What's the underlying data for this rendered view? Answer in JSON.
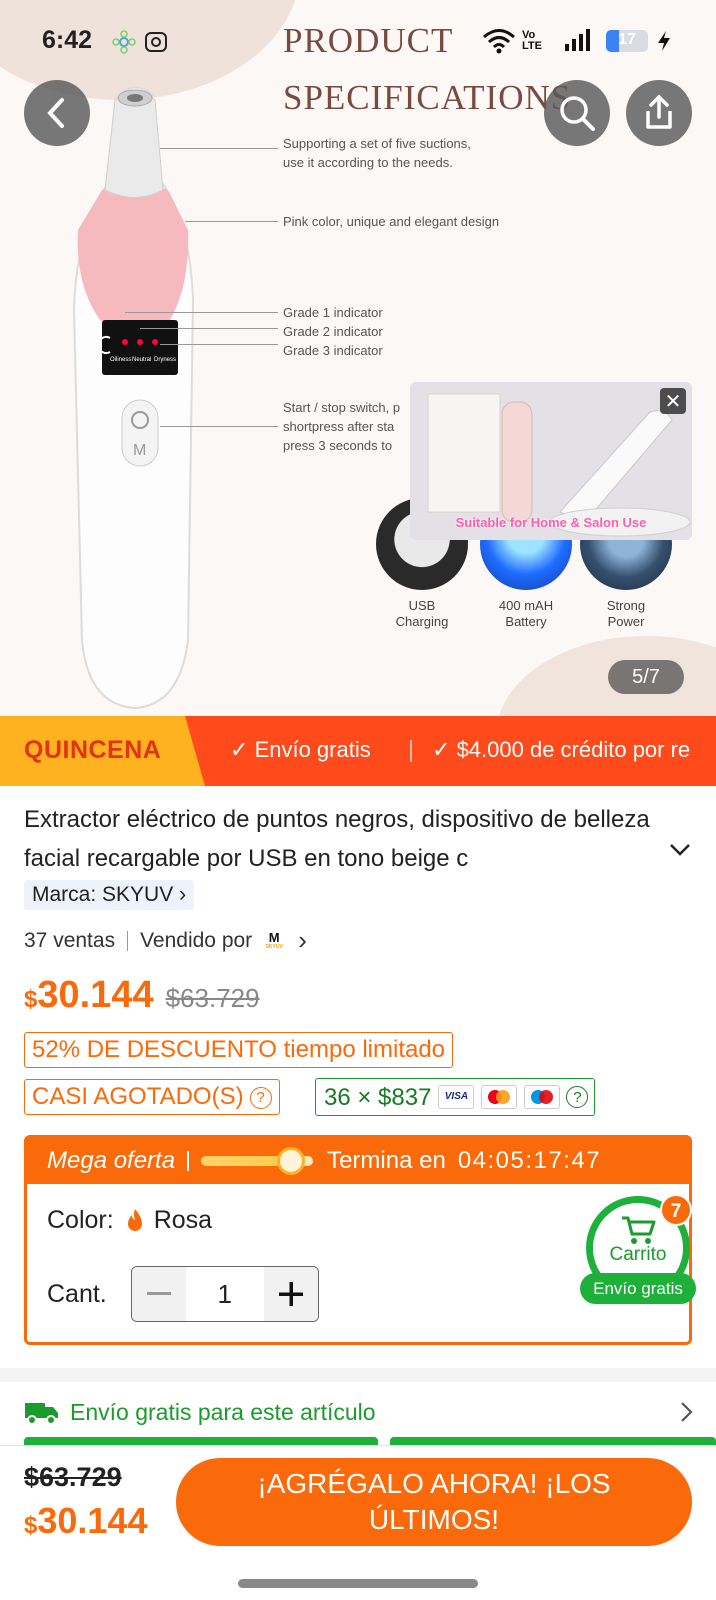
{
  "status_bar": {
    "time": "6:42",
    "network": "Vo LTE",
    "battery": "17"
  },
  "gallery": {
    "page_indicator": "5/7",
    "spec_title_line1": "PRODUCT",
    "spec_title_line2": "SPECIFICATIONS",
    "notes": [
      "Supporting a set of five suctions,",
      "use it according to the needs.",
      "Pink color, unique and elegant design",
      "Grade 1 indicator",
      "Grade 2 indicator",
      "Grade 3 indicator",
      "Start / stop switch, p",
      "shortpress after sta",
      "press 3 seconds to"
    ],
    "video_caption": "Suitable for Home & Salon Use",
    "features": [
      {
        "line1": "USB",
        "line2": "Charging"
      },
      {
        "line1": "400 mAH",
        "line2": "Battery"
      },
      {
        "line1": "Strong",
        "line2": "Power"
      }
    ],
    "device_mode_labels": [
      "Oiliness",
      "Neutral",
      "Dryness"
    ]
  },
  "promo": {
    "tag": "QUINCENA",
    "items": [
      "Envío gratis",
      "$4.000 de crédito por re"
    ]
  },
  "product": {
    "title": "Extractor eléctrico de puntos negros, dispositivo de belleza facial recargable por USB en tono beige c",
    "brand": "Marca: SKYUV",
    "sales": "37 ventas",
    "sold_by": "Vendido por",
    "seller_logo_letter": "M",
    "seller_logo_text": "SKYUV",
    "currency": "$",
    "price": "30.144",
    "old_price": "$63.729",
    "discount_badge": "52% DE DESCUENTO tiempo limitado",
    "stock_badge": "CASI AGOTADO(S)",
    "installments": "36 × $837",
    "payment_cards": [
      "VISA",
      "mastercard",
      "maestro"
    ]
  },
  "mega_offer": {
    "label": "Mega oferta",
    "ends_label": "Termina en",
    "timer": "04:05:17:47",
    "color_label": "Color:",
    "color_value": "Rosa",
    "qty_label": "Cant.",
    "qty_value": "1"
  },
  "cart": {
    "label": "Carrito",
    "count": "7",
    "shipping": "Envío gratis"
  },
  "shipping_row": {
    "text": "Envío gratis para este artículo"
  },
  "bottom_bar": {
    "old_price": "$63.729",
    "currency": "$",
    "price": "30.144",
    "cta": "¡AGRÉGALO AHORA! ¡LOS ÚLTIMOS!"
  },
  "colors": {
    "accent": "#fa6a0a",
    "green": "#1db13a",
    "promo_red": "#ff4a1c",
    "promo_yellow": "#ffb21f"
  }
}
